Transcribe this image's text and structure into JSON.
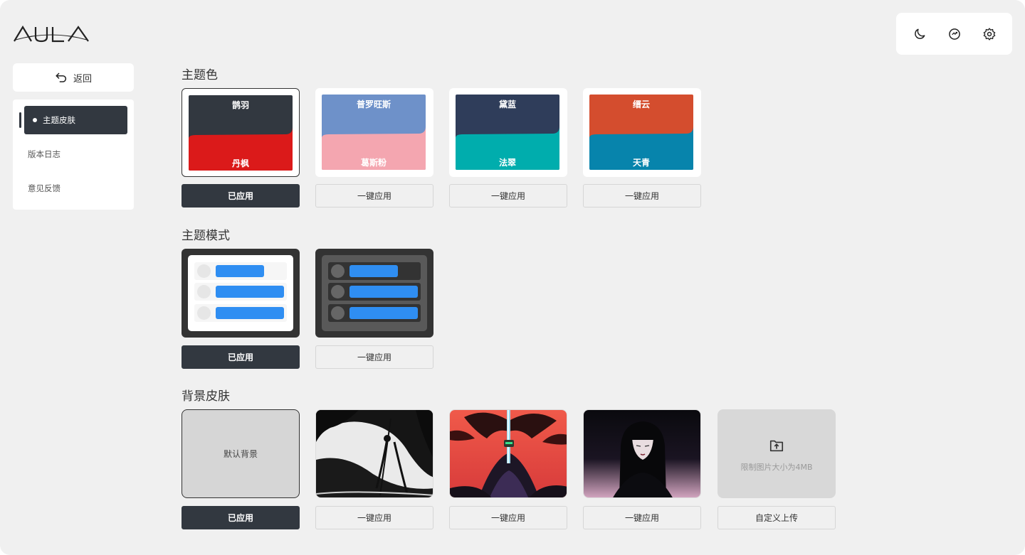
{
  "brand": {
    "logo_text": "AULA"
  },
  "header": {
    "actions": [
      {
        "name": "dark-mode",
        "icon": "moon-icon"
      },
      {
        "name": "sync",
        "icon": "refresh-icon"
      },
      {
        "name": "settings",
        "icon": "gear-icon"
      }
    ]
  },
  "sidebar": {
    "back_label": "返回",
    "items": [
      {
        "label": "主题皮肤",
        "active": true
      },
      {
        "label": "版本日志",
        "active": false
      },
      {
        "label": "意见反馈",
        "active": false
      }
    ]
  },
  "sections": {
    "theme_color": "主题色",
    "theme_mode": "主题模式",
    "background_skin": "背景皮肤"
  },
  "theme_colors": [
    {
      "top_name": "鹊羽",
      "bottom_name": "丹枫",
      "top_color": "#323840",
      "bottom_color": "#db1a1a",
      "button": "已应用",
      "applied": true
    },
    {
      "top_name": "普罗旺斯",
      "bottom_name": "葛斯粉",
      "top_color": "#6e91c9",
      "bottom_color": "#f4a6b0",
      "button": "一键应用",
      "applied": false
    },
    {
      "top_name": "黛蓝",
      "bottom_name": "法翠",
      "top_color": "#2f3d5a",
      "bottom_color": "#00adad",
      "button": "一键应用",
      "applied": false
    },
    {
      "top_name": "缙云",
      "bottom_name": "天青",
      "top_color": "#d44d2e",
      "bottom_color": "#0784ac",
      "button": "一键应用",
      "applied": false
    }
  ],
  "theme_modes": [
    {
      "mode": "light",
      "button": "已应用",
      "applied": true
    },
    {
      "mode": "dark",
      "button": "一键应用",
      "applied": false
    }
  ],
  "backgrounds": [
    {
      "kind": "default",
      "label": "默认背景",
      "button": "已应用",
      "applied": true
    },
    {
      "kind": "image",
      "button": "一键应用",
      "applied": false
    },
    {
      "kind": "image",
      "button": "一键应用",
      "applied": false
    },
    {
      "kind": "image",
      "button": "一键应用",
      "applied": false
    },
    {
      "kind": "upload",
      "hint": "限制图片大小为4MB",
      "button": "自定义上传",
      "applied": false
    }
  ]
}
